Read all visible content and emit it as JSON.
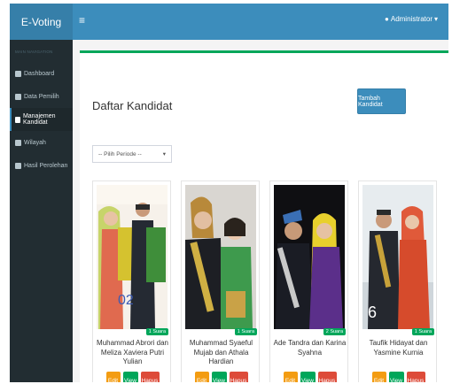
{
  "app": {
    "brand": "E-Voting"
  },
  "topbar": {
    "menu_icon": "≡",
    "user_label": "Administrator"
  },
  "sidebar": {
    "header": "MAIN NAVIGATION",
    "items": [
      {
        "label": "Dashboard",
        "icon": "dashboard-icon"
      },
      {
        "label": "Data Pemilih",
        "icon": "users-icon"
      },
      {
        "label": "Manajemen Kandidat",
        "icon": "users-icon",
        "active": true
      },
      {
        "label": "Wilayah",
        "icon": "building-icon"
      },
      {
        "label": "Hasil Perolehan",
        "icon": "chart-icon"
      }
    ]
  },
  "page": {
    "title": "Daftar Kandidat",
    "add_button": "Tambah Kandidat",
    "period_select": "-- Pilih Periode --"
  },
  "candidates": [
    {
      "name": "Muhammad Abrori dan Meliza Xaviera Putri Yulian",
      "votes": "1 Suara",
      "photo_text": "02"
    },
    {
      "name": "Muhammad Syaeful Mujab dan Athala Hardian",
      "votes": "1 Suara"
    },
    {
      "name": "Ade Tandra dan Karina Syahna",
      "votes": "2 Suara"
    },
    {
      "name": "Taufik Hidayat dan Yasmine Kurnia",
      "votes": "1 Suara",
      "photo_text": "6"
    }
  ],
  "buttons": {
    "edit": "Edit",
    "view": "View",
    "delete": "Hapus"
  },
  "colors": {
    "primary": "#3c8dbc",
    "success": "#00a65a",
    "warning": "#f39c12",
    "danger": "#dd4b39",
    "sidebar": "#222d32"
  }
}
